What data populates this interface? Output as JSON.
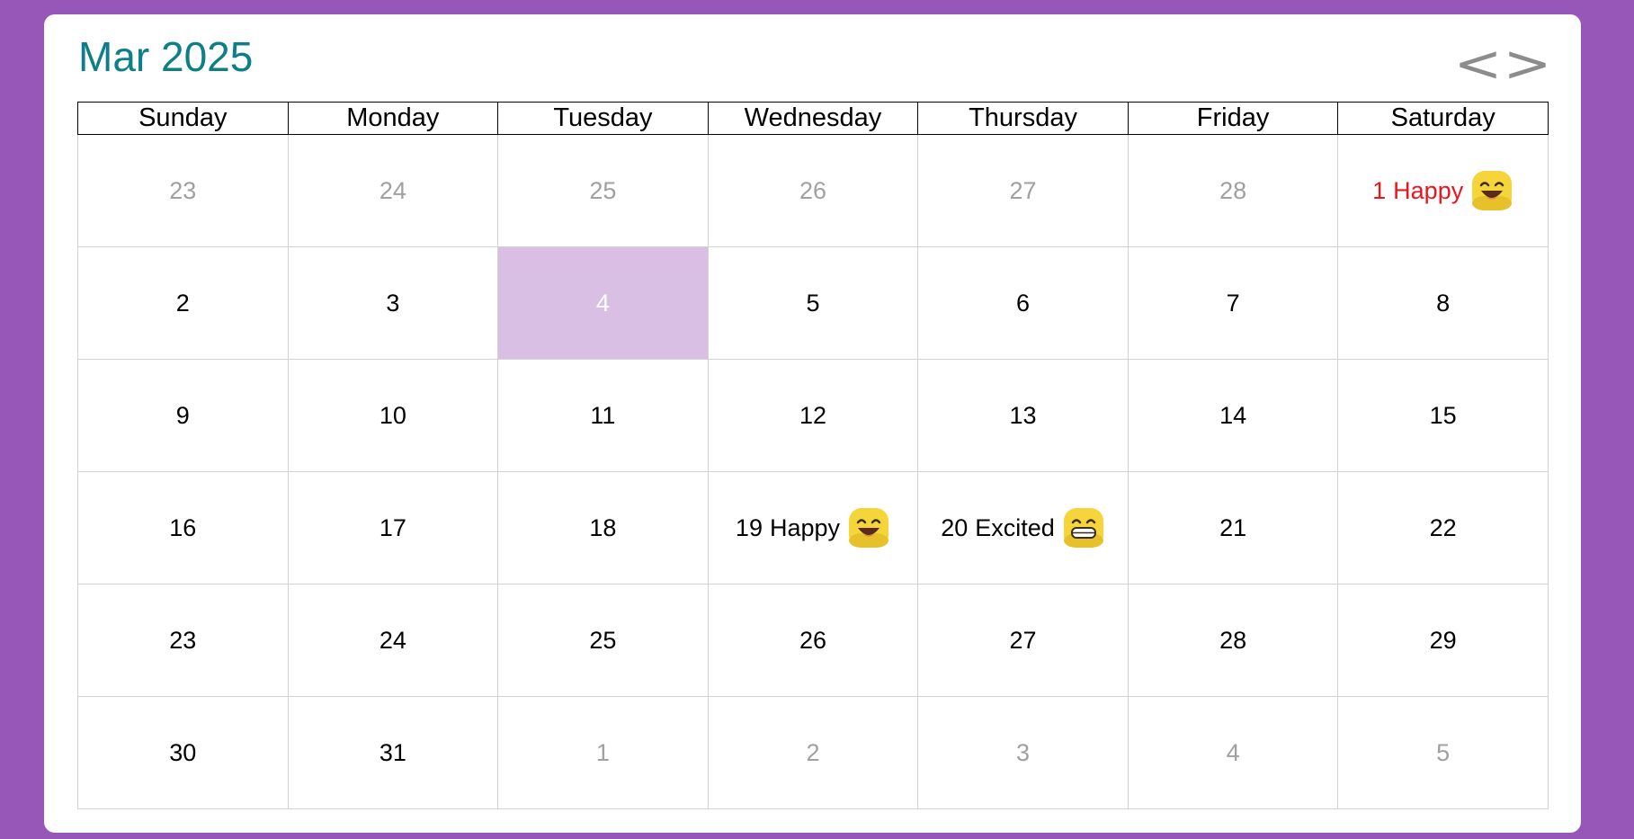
{
  "header": {
    "title": "Mar 2025",
    "prev_label": "<",
    "next_label": ">"
  },
  "weekdays": [
    "Sunday",
    "Monday",
    "Tuesday",
    "Wednesday",
    "Thursday",
    "Friday",
    "Saturday"
  ],
  "weeks": [
    [
      {
        "day": "23",
        "state": "muted"
      },
      {
        "day": "24",
        "state": "muted"
      },
      {
        "day": "25",
        "state": "muted"
      },
      {
        "day": "26",
        "state": "muted"
      },
      {
        "day": "27",
        "state": "muted"
      },
      {
        "day": "28",
        "state": "muted"
      },
      {
        "day": "1",
        "state": "special",
        "mood": "Happy",
        "icon": "happy-face-icon"
      }
    ],
    [
      {
        "day": "2"
      },
      {
        "day": "3"
      },
      {
        "day": "4",
        "state": "today"
      },
      {
        "day": "5"
      },
      {
        "day": "6"
      },
      {
        "day": "7"
      },
      {
        "day": "8"
      }
    ],
    [
      {
        "day": "9"
      },
      {
        "day": "10"
      },
      {
        "day": "11"
      },
      {
        "day": "12"
      },
      {
        "day": "13"
      },
      {
        "day": "14"
      },
      {
        "day": "15"
      }
    ],
    [
      {
        "day": "16"
      },
      {
        "day": "17"
      },
      {
        "day": "18"
      },
      {
        "day": "19",
        "mood": "Happy",
        "icon": "happy-face-icon"
      },
      {
        "day": "20",
        "mood": "Excited",
        "icon": "excited-face-icon"
      },
      {
        "day": "21"
      },
      {
        "day": "22"
      }
    ],
    [
      {
        "day": "23"
      },
      {
        "day": "24"
      },
      {
        "day": "25"
      },
      {
        "day": "26"
      },
      {
        "day": "27"
      },
      {
        "day": "28"
      },
      {
        "day": "29"
      }
    ],
    [
      {
        "day": "30"
      },
      {
        "day": "31"
      },
      {
        "day": "1",
        "state": "muted"
      },
      {
        "day": "2",
        "state": "muted"
      },
      {
        "day": "3",
        "state": "muted"
      },
      {
        "day": "4",
        "state": "muted"
      },
      {
        "day": "5",
        "state": "muted"
      }
    ]
  ],
  "colors": {
    "background": "#9757b8",
    "title": "#0e7f88",
    "today_highlight": "#d8bfe3",
    "special_text": "#e8161d",
    "muted_text": "#a0a0a0",
    "emoji": "#f5d53a"
  }
}
